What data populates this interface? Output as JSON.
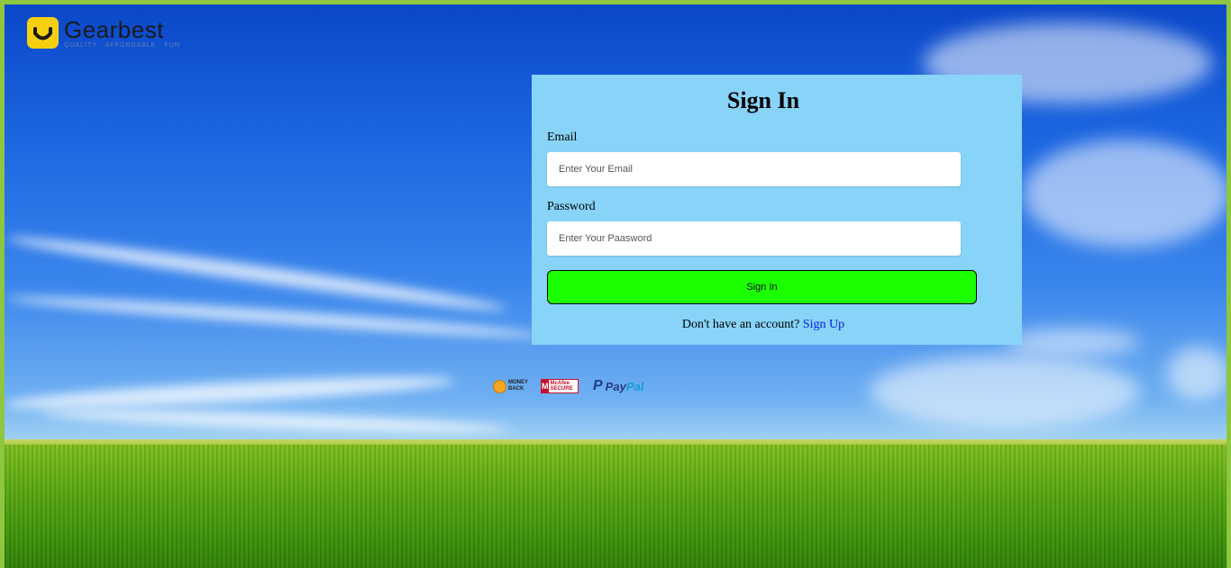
{
  "brand": {
    "name": "Gearbest",
    "tagline": "QUALITY · AFFORDABLE · FUN",
    "color": "#f6cf0f"
  },
  "form": {
    "title": "Sign In",
    "email_label": "Email",
    "email_placeholder": "Enter Your Email",
    "email_value": "",
    "password_label": "Password",
    "password_placeholder": "Enter Your Paasword",
    "password_value": "",
    "submit_label": "Sign In",
    "signup_prompt": "Don't have an account?",
    "signup_link": "Sign Up",
    "panel_color": "#88d4f9",
    "button_color": "#1cff00",
    "link_color": "#0a1ee0"
  },
  "badges": {
    "money_back": "MONEY BACK",
    "mcafee": "McAfee SECURE",
    "paypal_pay": "Pay",
    "paypal_pal": "Pal"
  }
}
